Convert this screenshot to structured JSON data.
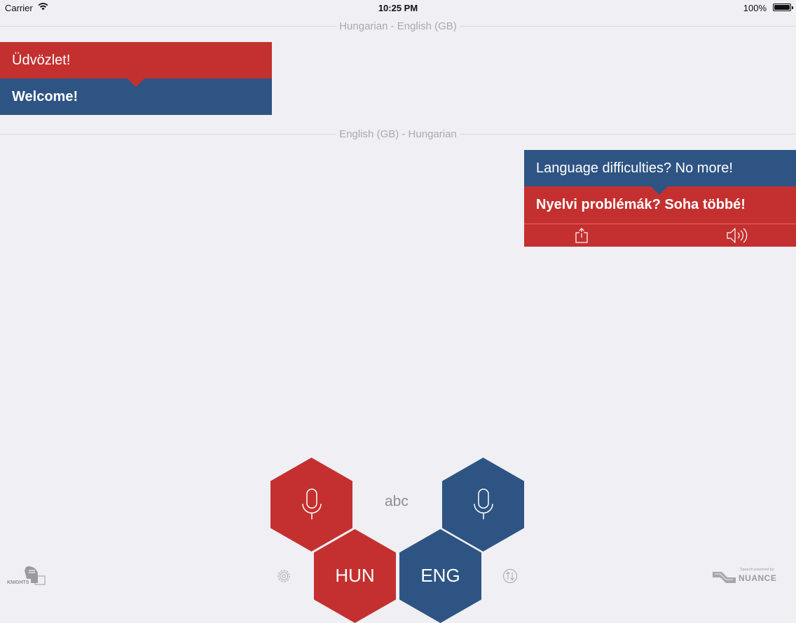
{
  "status_bar": {
    "carrier": "Carrier",
    "time": "10:25 PM",
    "battery": "100%"
  },
  "conversations": [
    {
      "direction_label": "Hungarian - English (GB)",
      "source_text": "Üdvözlet!",
      "translation_text": "Welcome!",
      "source_color": "#c4302f",
      "translation_color": "#2e5483"
    },
    {
      "direction_label": "English (GB) - Hungarian",
      "source_text": "Language difficulties? No more!",
      "translation_text": "Nyelvi problémák? Soha többé!",
      "source_color": "#2e5483",
      "translation_color": "#c4302f",
      "actions": [
        "share-icon",
        "speaker-icon"
      ]
    }
  ],
  "controls": {
    "left_mic_icon": "microphone-icon",
    "right_mic_icon": "microphone-icon",
    "keyboard_label": "abc",
    "left_language": "HUN",
    "right_language": "ENG",
    "settings_icon": "gear-icon",
    "swap_icon": "swap-languages-icon"
  },
  "branding": {
    "left_logo_text": "KNIGHTS",
    "right_logo_caption": "Speech powered by",
    "right_logo_text": "NUANCE"
  },
  "colors": {
    "red": "#c4302f",
    "blue": "#2e5483",
    "background": "#efeff4"
  }
}
